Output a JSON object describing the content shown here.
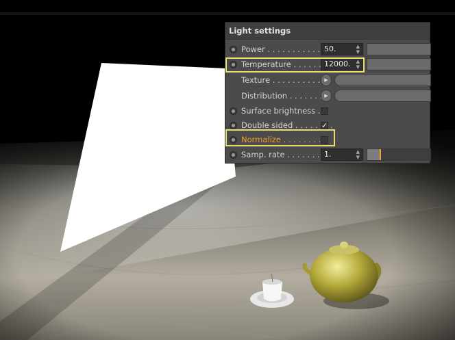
{
  "panel": {
    "title": "Light settings",
    "rows": [
      {
        "label": "Power",
        "dots": " . . . . . . . . . . . . . .",
        "value": "50."
      },
      {
        "label": "Temperature",
        "dots": " . . . . . . . .",
        "value": "12000."
      },
      {
        "label": "Texture",
        "dots": " . . . . . . . . . . . ."
      },
      {
        "label": "Distribution",
        "dots": " . . . . . . . ."
      },
      {
        "label": "Surface brightness",
        "dots": " . ."
      },
      {
        "label": "Double sided",
        "dots": " . . . . . . . .",
        "checkmark": "✓"
      },
      {
        "label": "Normalize",
        "dots": " . . . . . . . . .",
        "color": "#f0a22a"
      },
      {
        "label": "Samp. rate",
        "dots": " . . . . . . . . .",
        "value": "1.",
        "level": 0.2
      }
    ]
  },
  "spin_arrows": "▲▼",
  "highlight_color": "#e8e06a",
  "icons": [
    "radio-button-icon",
    "spin-arrows-icon",
    "play-arrow-icon",
    "checkmark-icon"
  ]
}
